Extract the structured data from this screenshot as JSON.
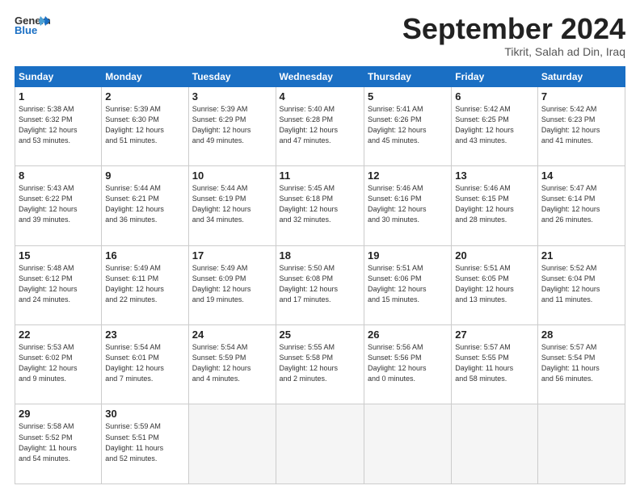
{
  "header": {
    "logo_general": "General",
    "logo_blue": "Blue",
    "month_title": "September 2024",
    "subtitle": "Tikrit, Salah ad Din, Iraq"
  },
  "columns": [
    "Sunday",
    "Monday",
    "Tuesday",
    "Wednesday",
    "Thursday",
    "Friday",
    "Saturday"
  ],
  "weeks": [
    [
      {
        "day": "1",
        "sunrise": "5:38 AM",
        "sunset": "6:32 PM",
        "daylight": "12 hours and 53 minutes."
      },
      {
        "day": "2",
        "sunrise": "5:39 AM",
        "sunset": "6:30 PM",
        "daylight": "12 hours and 51 minutes."
      },
      {
        "day": "3",
        "sunrise": "5:39 AM",
        "sunset": "6:29 PM",
        "daylight": "12 hours and 49 minutes."
      },
      {
        "day": "4",
        "sunrise": "5:40 AM",
        "sunset": "6:28 PM",
        "daylight": "12 hours and 47 minutes."
      },
      {
        "day": "5",
        "sunrise": "5:41 AM",
        "sunset": "6:26 PM",
        "daylight": "12 hours and 45 minutes."
      },
      {
        "day": "6",
        "sunrise": "5:42 AM",
        "sunset": "6:25 PM",
        "daylight": "12 hours and 43 minutes."
      },
      {
        "day": "7",
        "sunrise": "5:42 AM",
        "sunset": "6:23 PM",
        "daylight": "12 hours and 41 minutes."
      }
    ],
    [
      {
        "day": "8",
        "sunrise": "5:43 AM",
        "sunset": "6:22 PM",
        "daylight": "12 hours and 39 minutes."
      },
      {
        "day": "9",
        "sunrise": "5:44 AM",
        "sunset": "6:21 PM",
        "daylight": "12 hours and 36 minutes."
      },
      {
        "day": "10",
        "sunrise": "5:44 AM",
        "sunset": "6:19 PM",
        "daylight": "12 hours and 34 minutes."
      },
      {
        "day": "11",
        "sunrise": "5:45 AM",
        "sunset": "6:18 PM",
        "daylight": "12 hours and 32 minutes."
      },
      {
        "day": "12",
        "sunrise": "5:46 AM",
        "sunset": "6:16 PM",
        "daylight": "12 hours and 30 minutes."
      },
      {
        "day": "13",
        "sunrise": "5:46 AM",
        "sunset": "6:15 PM",
        "daylight": "12 hours and 28 minutes."
      },
      {
        "day": "14",
        "sunrise": "5:47 AM",
        "sunset": "6:14 PM",
        "daylight": "12 hours and 26 minutes."
      }
    ],
    [
      {
        "day": "15",
        "sunrise": "5:48 AM",
        "sunset": "6:12 PM",
        "daylight": "12 hours and 24 minutes."
      },
      {
        "day": "16",
        "sunrise": "5:49 AM",
        "sunset": "6:11 PM",
        "daylight": "12 hours and 22 minutes."
      },
      {
        "day": "17",
        "sunrise": "5:49 AM",
        "sunset": "6:09 PM",
        "daylight": "12 hours and 19 minutes."
      },
      {
        "day": "18",
        "sunrise": "5:50 AM",
        "sunset": "6:08 PM",
        "daylight": "12 hours and 17 minutes."
      },
      {
        "day": "19",
        "sunrise": "5:51 AM",
        "sunset": "6:06 PM",
        "daylight": "12 hours and 15 minutes."
      },
      {
        "day": "20",
        "sunrise": "5:51 AM",
        "sunset": "6:05 PM",
        "daylight": "12 hours and 13 minutes."
      },
      {
        "day": "21",
        "sunrise": "5:52 AM",
        "sunset": "6:04 PM",
        "daylight": "12 hours and 11 minutes."
      }
    ],
    [
      {
        "day": "22",
        "sunrise": "5:53 AM",
        "sunset": "6:02 PM",
        "daylight": "12 hours and 9 minutes."
      },
      {
        "day": "23",
        "sunrise": "5:54 AM",
        "sunset": "6:01 PM",
        "daylight": "12 hours and 7 minutes."
      },
      {
        "day": "24",
        "sunrise": "5:54 AM",
        "sunset": "5:59 PM",
        "daylight": "12 hours and 4 minutes."
      },
      {
        "day": "25",
        "sunrise": "5:55 AM",
        "sunset": "5:58 PM",
        "daylight": "12 hours and 2 minutes."
      },
      {
        "day": "26",
        "sunrise": "5:56 AM",
        "sunset": "5:56 PM",
        "daylight": "12 hours and 0 minutes."
      },
      {
        "day": "27",
        "sunrise": "5:57 AM",
        "sunset": "5:55 PM",
        "daylight": "11 hours and 58 minutes."
      },
      {
        "day": "28",
        "sunrise": "5:57 AM",
        "sunset": "5:54 PM",
        "daylight": "11 hours and 56 minutes."
      }
    ],
    [
      {
        "day": "29",
        "sunrise": "5:58 AM",
        "sunset": "5:52 PM",
        "daylight": "11 hours and 54 minutes."
      },
      {
        "day": "30",
        "sunrise": "5:59 AM",
        "sunset": "5:51 PM",
        "daylight": "11 hours and 52 minutes."
      },
      null,
      null,
      null,
      null,
      null
    ]
  ],
  "labels": {
    "sunrise": "Sunrise:",
    "sunset": "Sunset:",
    "daylight": "Daylight:"
  }
}
